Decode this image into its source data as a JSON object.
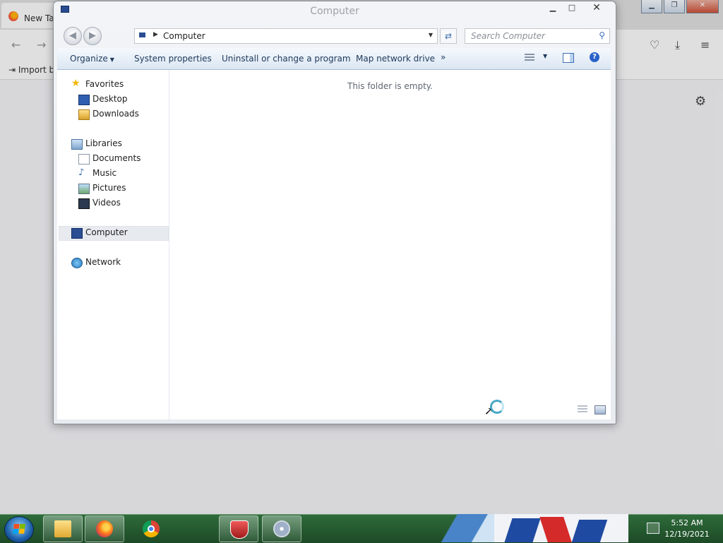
{
  "browser": {
    "tab_title": "New Tab",
    "bookmarks_import": "Import bookmarks..."
  },
  "explorer": {
    "window_title": "Computer",
    "address_crumb": "Computer",
    "search_placeholder": "Search Computer",
    "command_bar": {
      "organize": "Organize",
      "system_properties": "System properties",
      "uninstall": "Uninstall or change a program",
      "map_drive": "Map network drive",
      "more": "»"
    },
    "nav": {
      "favorites": "Favorites",
      "desktop": "Desktop",
      "downloads": "Downloads",
      "libraries": "Libraries",
      "documents": "Documents",
      "music": "Music",
      "pictures": "Pictures",
      "videos": "Videos",
      "computer": "Computer",
      "network": "Network"
    },
    "empty_message": "This folder is empty."
  },
  "taskbar": {
    "time": "5:52 AM",
    "date": "12/19/2021"
  },
  "colors": {
    "taskbar": "#2e6b3a",
    "command_bar": "#dbe6f3",
    "selection": "#e7ebf0"
  }
}
